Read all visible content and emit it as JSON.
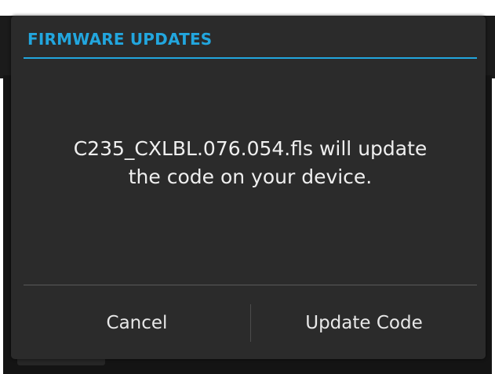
{
  "dialog": {
    "title": "FIRMWARE UPDATES",
    "message_line1": "C235_CXLBL.076.054.fls will update",
    "message_line2": "the code on your device.",
    "buttons": {
      "cancel_label": "Cancel",
      "confirm_label": "Update Code"
    }
  },
  "colors": {
    "accent": "#22a6de",
    "dialog_background": "#2b2b2b",
    "text": "#efefef"
  }
}
